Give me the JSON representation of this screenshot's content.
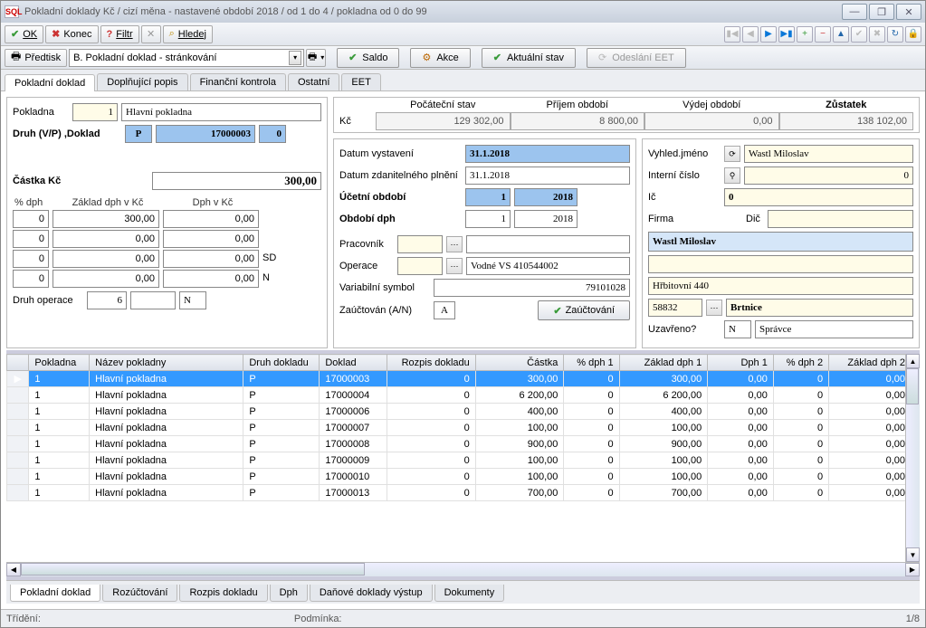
{
  "window": {
    "title": "Pokladní doklady Kč / cizí měna - nastavené období 2018 / od 1 do 4 / pokladna od 0 do 99"
  },
  "toolbar": {
    "ok": "OK",
    "konec": "Konec",
    "filtr": "Filtr",
    "hledej": "Hledej"
  },
  "toolbar2": {
    "predtisk": "Předtisk",
    "combo": "B. Pokladní doklad - stránkování",
    "saldo": "Saldo",
    "akce": "Akce",
    "aktualni": "Aktuální stav",
    "eet": "Odeslání EET"
  },
  "tabs": {
    "t1": "Pokladní doklad",
    "t2": "Doplňující popis",
    "t3": "Finanční kontrola",
    "t4": "Ostatní",
    "t5": "EET"
  },
  "left": {
    "pokladna_lbl": "Pokladna",
    "pokladna_no": "1",
    "pokladna_name": "Hlavní pokladna",
    "druh_lbl": "Druh (V/P) ,Doklad",
    "druh": "P",
    "doklad": "17000003",
    "rozp": "0",
    "castka_lbl": "Částka Kč",
    "castka": "300,00",
    "dph_pct": "% dph",
    "dph_zaklad": "Základ dph v Kč",
    "dph_dph": "Dph v Kč",
    "dph_rows": [
      {
        "p": "0",
        "z": "300,00",
        "d": "0,00",
        "suf": ""
      },
      {
        "p": "0",
        "z": "0,00",
        "d": "0,00",
        "suf": ""
      },
      {
        "p": "0",
        "z": "0,00",
        "d": "0,00",
        "suf": "SD"
      },
      {
        "p": "0",
        "z": "0,00",
        "d": "0,00",
        "suf": "N"
      }
    ],
    "druh_op_lbl": "Druh operace",
    "druh_op": "6",
    "druh_op2": "",
    "druh_op3": "N"
  },
  "summary": {
    "kc": "Kč",
    "poc_lbl": "Počáteční stav",
    "poc": "129 302,00",
    "pri_lbl": "Příjem období",
    "pri": "8 800,00",
    "vyd_lbl": "Výdej období",
    "vyd": "0,00",
    "zus_lbl": "Zůstatek",
    "zus": "138 102,00"
  },
  "dates": {
    "dat_vyst_lbl": "Datum vystavení",
    "dat_vyst": "31.1.2018",
    "dat_zdan_lbl": "Datum zdanitelného plnění",
    "dat_zdan": "31.1.2018",
    "ucet_lbl": "Účetní období",
    "ucet_m": "1",
    "ucet_y": "2018",
    "obd_dph_lbl": "Období dph",
    "obd_dph_m": "1",
    "obd_dph_y": "2018",
    "prac_lbl": "Pracovník",
    "prac_val": "",
    "oper_lbl": "Operace",
    "oper_val": "Vodné VS 410544002",
    "vs_lbl": "Variabilní symbol",
    "vs": "79101028",
    "zauc_lbl": "Zaúčtován (A/N)",
    "zauc": "A",
    "zauc_btn": "Zaúčtování"
  },
  "partner": {
    "vyhl_lbl": "Vyhled.jméno",
    "vyhl": "Wastl Miloslav",
    "int_lbl": "Interní číslo",
    "int": "0",
    "ic_lbl": "Ič",
    "ic": "0",
    "firma_lbl": "Firma",
    "dic_lbl": "Dič",
    "dic": "",
    "name": "Wastl Miloslav",
    "addr1": "",
    "addr2": "Hřbitovní 440",
    "psc": "58832",
    "mesto": "Brtnice",
    "uzav_lbl": "Uzavřeno?",
    "uzav": "N",
    "spravce": "Správce"
  },
  "grid": {
    "cols": [
      "Pokladna",
      "Název pokladny",
      "Druh dokladu",
      "Doklad",
      "Rozpis dokladu",
      "Částka",
      "% dph 1",
      "Základ dph 1",
      "Dph 1",
      "% dph 2",
      "Základ dph 2"
    ],
    "rows": [
      {
        "sel": true,
        "c": [
          "1",
          "Hlavní pokladna",
          "P",
          "17000003",
          "0",
          "300,00",
          "0",
          "300,00",
          "0,00",
          "0",
          "0,00"
        ]
      },
      {
        "sel": false,
        "c": [
          "1",
          "Hlavní pokladna",
          "P",
          "17000004",
          "0",
          "6 200,00",
          "0",
          "6 200,00",
          "0,00",
          "0",
          "0,00"
        ]
      },
      {
        "sel": false,
        "c": [
          "1",
          "Hlavní pokladna",
          "P",
          "17000006",
          "0",
          "400,00",
          "0",
          "400,00",
          "0,00",
          "0",
          "0,00"
        ]
      },
      {
        "sel": false,
        "c": [
          "1",
          "Hlavní pokladna",
          "P",
          "17000007",
          "0",
          "100,00",
          "0",
          "100,00",
          "0,00",
          "0",
          "0,00"
        ]
      },
      {
        "sel": false,
        "c": [
          "1",
          "Hlavní pokladna",
          "P",
          "17000008",
          "0",
          "900,00",
          "0",
          "900,00",
          "0,00",
          "0",
          "0,00"
        ]
      },
      {
        "sel": false,
        "c": [
          "1",
          "Hlavní pokladna",
          "P",
          "17000009",
          "0",
          "100,00",
          "0",
          "100,00",
          "0,00",
          "0",
          "0,00"
        ]
      },
      {
        "sel": false,
        "c": [
          "1",
          "Hlavní pokladna",
          "P",
          "17000010",
          "0",
          "100,00",
          "0",
          "100,00",
          "0,00",
          "0",
          "0,00"
        ]
      },
      {
        "sel": false,
        "c": [
          "1",
          "Hlavní pokladna",
          "P",
          "17000013",
          "0",
          "700,00",
          "0",
          "700,00",
          "0,00",
          "0",
          "0,00"
        ]
      }
    ]
  },
  "bottom_tabs": {
    "b1": "Pokladní doklad",
    "b2": "Rozúčtování",
    "b3": "Rozpis dokladu",
    "b4": "Dph",
    "b5": "Daňové doklady výstup",
    "b6": "Dokumenty"
  },
  "status": {
    "left": "Třídění:",
    "mid": "Podmínka:",
    "right": "1/8"
  }
}
